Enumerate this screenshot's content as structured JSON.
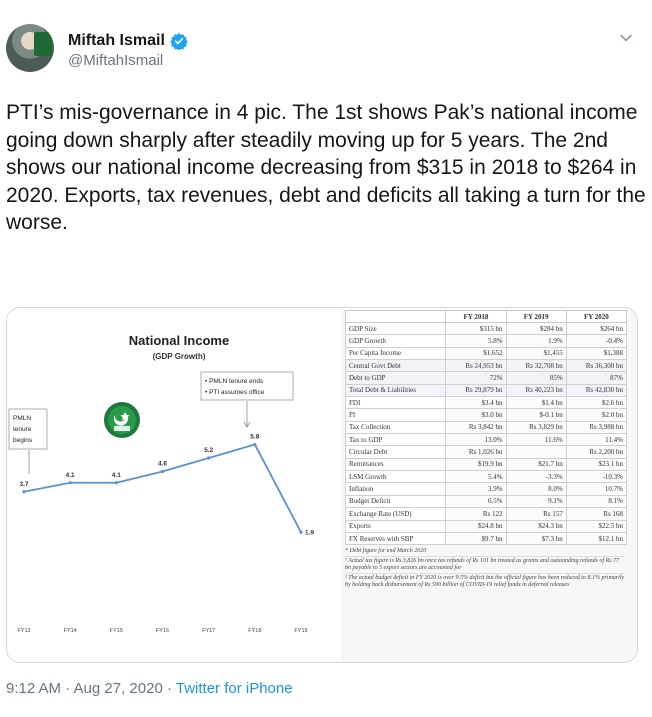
{
  "user": {
    "name": "Miftah Ismail",
    "handle": "@MiftahIsmail"
  },
  "tweet": {
    "text": "PTI’s mis-governance in 4 pic. The 1st shows Pak’s national income going down sharply after steadily moving up for 5 years. The 2nd shows our national income decreasing from $315 in 2018 to $264 in 2020. Exports, tax revenues, debt and deficits all taking a turn for the worse.",
    "time": "9:12 AM · Aug 27, 2020",
    "separator": " · ",
    "source": "Twitter for iPhone"
  },
  "chart_data": {
    "type": "line",
    "title": "National Income",
    "subtitle": "(GDP Growth)",
    "categories": [
      "FY13",
      "FY14",
      "FY15",
      "FY16",
      "FY17",
      "FY18",
      "FY19"
    ],
    "values": [
      3.7,
      4.1,
      4.1,
      4.6,
      5.2,
      5.8,
      1.9
    ],
    "annotations": {
      "pmln": [
        "PMLN",
        "tenure",
        "begins"
      ],
      "pti": [
        "• PMLN tenure ends",
        "• PTI assumes office"
      ]
    },
    "grid": false,
    "colors": {
      "line": "#5b8fd6",
      "label": "#333333",
      "arrow": "#888888"
    }
  },
  "table": {
    "headers": [
      "",
      "FY 2018",
      "FY 2019",
      "FY 2020"
    ],
    "rows": [
      [
        "GDP Size",
        "$315 bn",
        "$284 bn",
        "$264 bn"
      ],
      [
        "GDP Growth",
        "5.8%",
        "1.9%",
        "-0.4%"
      ],
      [
        "Per Capita Income",
        "$1,652",
        "$1,455",
        "$1,388"
      ],
      [
        "Central Govt Debt",
        "Rs 24,953 bn",
        "Rs 32,708 bn",
        "Rs 36,300 bn"
      ],
      [
        "Debt to GDP",
        "72%",
        "85%",
        "87%"
      ],
      [
        "Total Debt & Liabilities",
        "Rs 29,879 bn",
        "Rs 40,223 bn",
        "Rs 42,830 bn"
      ],
      [
        "FDI",
        "$3.4 bn",
        "$1.4 bn",
        "$2.6 bn"
      ],
      [
        "PI",
        "$3.0 bn",
        "$-0.1 bn",
        "$2.0 bn"
      ],
      [
        "Tax Collection",
        "Rs 3,842 bn",
        "Rs 3,829 bn",
        "Rs 3,988 bn"
      ],
      [
        "Tax to GDP",
        "13.0%",
        "11.6%",
        "11.4%"
      ],
      [
        "Circular Debt",
        "Rs 1,026 bn",
        "",
        "Rs 2,200 bn"
      ],
      [
        "Remittances",
        "$19.9 bn",
        "$21.7 bn",
        "$23.1 bn"
      ],
      [
        "LSM Growth",
        "5.4%",
        "-3.3%",
        "-10.3%"
      ],
      [
        "Inflation",
        "3.9%",
        "8.0%",
        "10.7%"
      ],
      [
        "Budget Deficit",
        "6.5%",
        "9.1%",
        "8.1%"
      ],
      [
        "Exchange Rate (USD)",
        "Rs 122",
        "Rs 157",
        "Rs 168"
      ],
      [
        "Exports",
        "$24.8 bn",
        "$24.3 bn",
        "$22.5 bn"
      ],
      [
        "FX Reserves with SBP",
        "$9.7 bn",
        "$7.3 bn",
        "$12.1 bn"
      ]
    ],
    "notes": [
      "* Debt figure for end March 2020",
      "¹ Actual tax figure is Rs 3,826 bn once tax refunds of Rs 101 bn treated as grants and outstanding refunds of Rs 77 bn payable to 5 export sectors are accounted for",
      "² The actual budget deficit in FY 2020 is over 9.5% deficit but the official figure has been reduced to 8.1% primarily by holding back disbursement of Rs 590 billion of COVID-19 relief funds in deferred releases"
    ]
  }
}
